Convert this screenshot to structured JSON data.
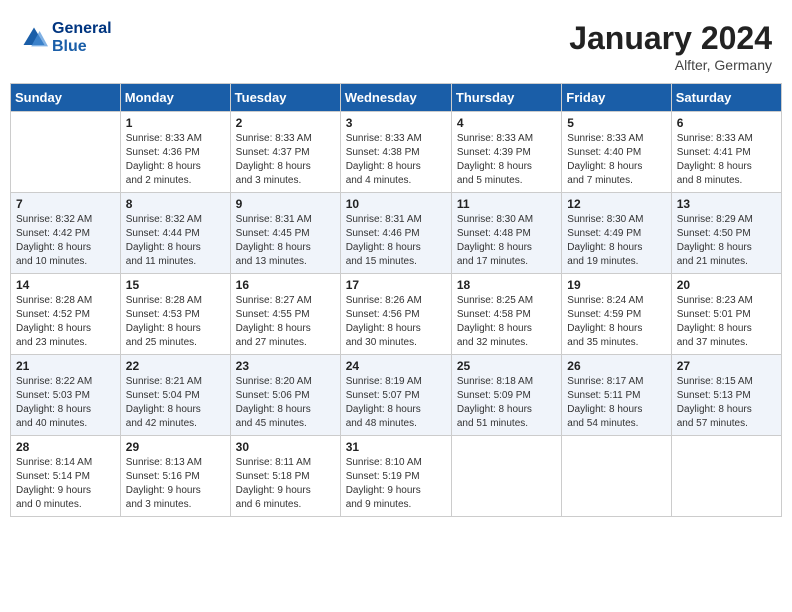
{
  "header": {
    "logo_line1": "General",
    "logo_line2": "Blue",
    "month": "January 2024",
    "location": "Alfter, Germany"
  },
  "columns": [
    "Sunday",
    "Monday",
    "Tuesday",
    "Wednesday",
    "Thursday",
    "Friday",
    "Saturday"
  ],
  "weeks": [
    [
      {
        "day": "",
        "content": ""
      },
      {
        "day": "1",
        "content": "Sunrise: 8:33 AM\nSunset: 4:36 PM\nDaylight: 8 hours\nand 2 minutes."
      },
      {
        "day": "2",
        "content": "Sunrise: 8:33 AM\nSunset: 4:37 PM\nDaylight: 8 hours\nand 3 minutes."
      },
      {
        "day": "3",
        "content": "Sunrise: 8:33 AM\nSunset: 4:38 PM\nDaylight: 8 hours\nand 4 minutes."
      },
      {
        "day": "4",
        "content": "Sunrise: 8:33 AM\nSunset: 4:39 PM\nDaylight: 8 hours\nand 5 minutes."
      },
      {
        "day": "5",
        "content": "Sunrise: 8:33 AM\nSunset: 4:40 PM\nDaylight: 8 hours\nand 7 minutes."
      },
      {
        "day": "6",
        "content": "Sunrise: 8:33 AM\nSunset: 4:41 PM\nDaylight: 8 hours\nand 8 minutes."
      }
    ],
    [
      {
        "day": "7",
        "content": "Sunrise: 8:32 AM\nSunset: 4:42 PM\nDaylight: 8 hours\nand 10 minutes."
      },
      {
        "day": "8",
        "content": "Sunrise: 8:32 AM\nSunset: 4:44 PM\nDaylight: 8 hours\nand 11 minutes."
      },
      {
        "day": "9",
        "content": "Sunrise: 8:31 AM\nSunset: 4:45 PM\nDaylight: 8 hours\nand 13 minutes."
      },
      {
        "day": "10",
        "content": "Sunrise: 8:31 AM\nSunset: 4:46 PM\nDaylight: 8 hours\nand 15 minutes."
      },
      {
        "day": "11",
        "content": "Sunrise: 8:30 AM\nSunset: 4:48 PM\nDaylight: 8 hours\nand 17 minutes."
      },
      {
        "day": "12",
        "content": "Sunrise: 8:30 AM\nSunset: 4:49 PM\nDaylight: 8 hours\nand 19 minutes."
      },
      {
        "day": "13",
        "content": "Sunrise: 8:29 AM\nSunset: 4:50 PM\nDaylight: 8 hours\nand 21 minutes."
      }
    ],
    [
      {
        "day": "14",
        "content": "Sunrise: 8:28 AM\nSunset: 4:52 PM\nDaylight: 8 hours\nand 23 minutes."
      },
      {
        "day": "15",
        "content": "Sunrise: 8:28 AM\nSunset: 4:53 PM\nDaylight: 8 hours\nand 25 minutes."
      },
      {
        "day": "16",
        "content": "Sunrise: 8:27 AM\nSunset: 4:55 PM\nDaylight: 8 hours\nand 27 minutes."
      },
      {
        "day": "17",
        "content": "Sunrise: 8:26 AM\nSunset: 4:56 PM\nDaylight: 8 hours\nand 30 minutes."
      },
      {
        "day": "18",
        "content": "Sunrise: 8:25 AM\nSunset: 4:58 PM\nDaylight: 8 hours\nand 32 minutes."
      },
      {
        "day": "19",
        "content": "Sunrise: 8:24 AM\nSunset: 4:59 PM\nDaylight: 8 hours\nand 35 minutes."
      },
      {
        "day": "20",
        "content": "Sunrise: 8:23 AM\nSunset: 5:01 PM\nDaylight: 8 hours\nand 37 minutes."
      }
    ],
    [
      {
        "day": "21",
        "content": "Sunrise: 8:22 AM\nSunset: 5:03 PM\nDaylight: 8 hours\nand 40 minutes."
      },
      {
        "day": "22",
        "content": "Sunrise: 8:21 AM\nSunset: 5:04 PM\nDaylight: 8 hours\nand 42 minutes."
      },
      {
        "day": "23",
        "content": "Sunrise: 8:20 AM\nSunset: 5:06 PM\nDaylight: 8 hours\nand 45 minutes."
      },
      {
        "day": "24",
        "content": "Sunrise: 8:19 AM\nSunset: 5:07 PM\nDaylight: 8 hours\nand 48 minutes."
      },
      {
        "day": "25",
        "content": "Sunrise: 8:18 AM\nSunset: 5:09 PM\nDaylight: 8 hours\nand 51 minutes."
      },
      {
        "day": "26",
        "content": "Sunrise: 8:17 AM\nSunset: 5:11 PM\nDaylight: 8 hours\nand 54 minutes."
      },
      {
        "day": "27",
        "content": "Sunrise: 8:15 AM\nSunset: 5:13 PM\nDaylight: 8 hours\nand 57 minutes."
      }
    ],
    [
      {
        "day": "28",
        "content": "Sunrise: 8:14 AM\nSunset: 5:14 PM\nDaylight: 9 hours\nand 0 minutes."
      },
      {
        "day": "29",
        "content": "Sunrise: 8:13 AM\nSunset: 5:16 PM\nDaylight: 9 hours\nand 3 minutes."
      },
      {
        "day": "30",
        "content": "Sunrise: 8:11 AM\nSunset: 5:18 PM\nDaylight: 9 hours\nand 6 minutes."
      },
      {
        "day": "31",
        "content": "Sunrise: 8:10 AM\nSunset: 5:19 PM\nDaylight: 9 hours\nand 9 minutes."
      },
      {
        "day": "",
        "content": ""
      },
      {
        "day": "",
        "content": ""
      },
      {
        "day": "",
        "content": ""
      }
    ]
  ]
}
